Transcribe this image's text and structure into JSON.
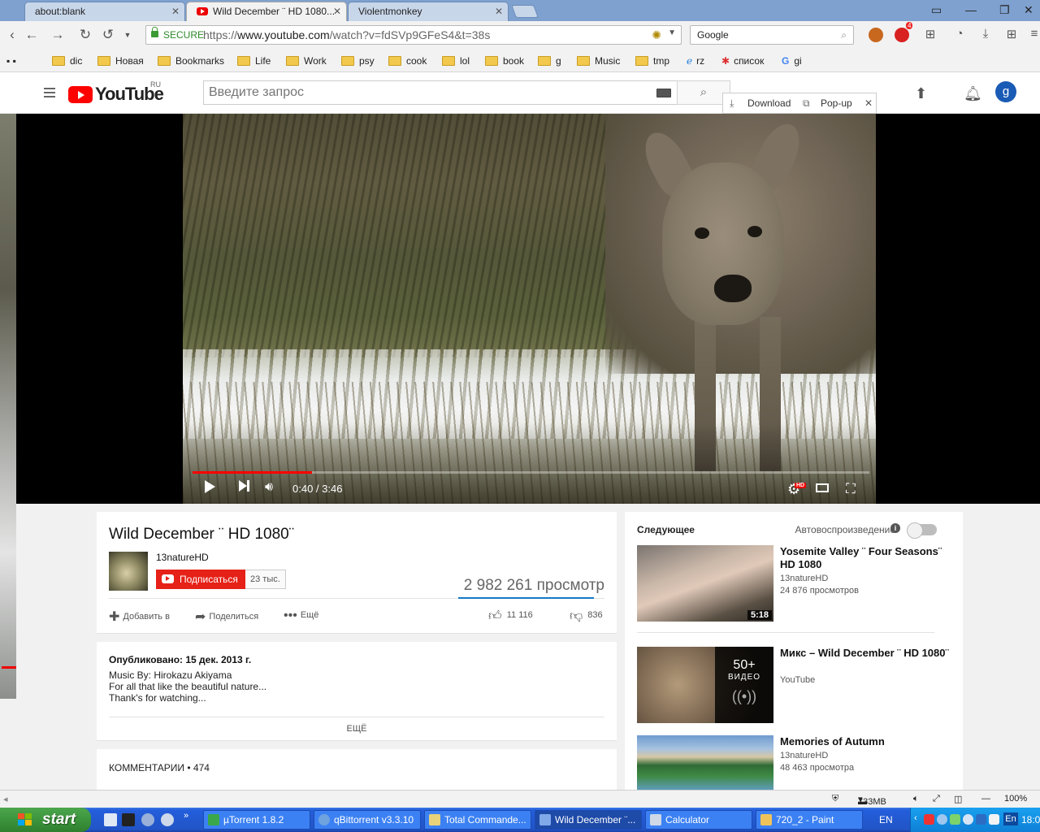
{
  "browser": {
    "tabs": [
      {
        "title": "about:blank"
      },
      {
        "title": "Wild December ¨ HD 1080..."
      },
      {
        "title": "Violentmonkey"
      }
    ],
    "omnibox": {
      "secure_label": "SECURE",
      "url_scheme": "https://",
      "url_host": "www.youtube.com",
      "url_path": "/watch?v=fdSVp9GFeS4&t=38s"
    },
    "search_engine": "Google",
    "extension_badge": "4",
    "bookmarks": [
      {
        "label": "dic"
      },
      {
        "label": "Новая"
      },
      {
        "label": "Bookmarks"
      },
      {
        "label": "Life"
      },
      {
        "label": "Work"
      },
      {
        "label": "psy"
      },
      {
        "label": "cook"
      },
      {
        "label": "lol"
      },
      {
        "label": "book"
      },
      {
        "label": "g"
      },
      {
        "label": "Music"
      },
      {
        "label": "tmp"
      },
      {
        "label": "rz"
      },
      {
        "label": "список"
      },
      {
        "label": "gi"
      }
    ]
  },
  "youtube": {
    "logo_text": "YouTube",
    "region": "RU",
    "search_placeholder": "Введите запрос",
    "download_label": "Download",
    "popup_label": "Pop-up",
    "avatar_letter": "g"
  },
  "player": {
    "time_current": "0:40",
    "time_total": "3:46",
    "time_display": "0:40 / 3:46",
    "progress_fraction": 0.177,
    "quality_badge": "HD"
  },
  "video": {
    "title": "Wild December ¨ HD 1080¨",
    "channel": "13natureHD",
    "subscribe_label": "Подписаться",
    "subscriber_count": "23 тыс.",
    "views": "2 982 261 просмотр",
    "actions": {
      "add": "Добавить в",
      "share": "Поделиться",
      "more": "Ещё"
    },
    "likes": "11 116",
    "dislikes": "836",
    "like_ratio": 0.93
  },
  "description": {
    "published": "Опубликовано: 15 дек. 2013 г.",
    "lines": [
      "Music By: Hirokazu Akiyama",
      "For all that like the beautiful nature...",
      "Thank's for watching..."
    ],
    "more_label": "ЕЩЁ"
  },
  "comments": {
    "label": "КОММЕНТАРИИ",
    "separator": " • ",
    "count": "474"
  },
  "sidebar": {
    "up_next": "Следующее",
    "autoplay_label": "Автовоспроизведение",
    "recs": [
      {
        "title": "Yosemite Valley ¨ Four Seasons¨ HD 1080",
        "channel": "13natureHD",
        "views": "24 876 просмотров",
        "duration": "5:18"
      },
      {
        "title": "Микс – Wild December ¨ HD 1080¨",
        "channel": "YouTube",
        "mix_count": "50+",
        "mix_label": "ВИДЕО"
      },
      {
        "title": "Memories of Autumn",
        "channel": "13natureHD",
        "views": "48 463 просмотра"
      }
    ]
  },
  "statusbar": {
    "memory": "733MB",
    "zoom": "100%"
  },
  "taskbar": {
    "start_label": "start",
    "tasks": [
      {
        "label": "µTorrent 1.8.2"
      },
      {
        "label": "qBittorrent v3.3.10"
      },
      {
        "label": "Total Commande..."
      },
      {
        "label": "Wild December ¨..."
      },
      {
        "label": "Calculator"
      },
      {
        "label": "720_2 - Paint"
      }
    ],
    "language": "EN",
    "tray_language": "En",
    "clock": "18:0"
  },
  "colors": {
    "youtube_red": "#ff0000",
    "subscribe_red": "#e62117",
    "link_blue": "#167ac6",
    "xp_blue": "#245edb",
    "xp_green": "#3c943c"
  }
}
